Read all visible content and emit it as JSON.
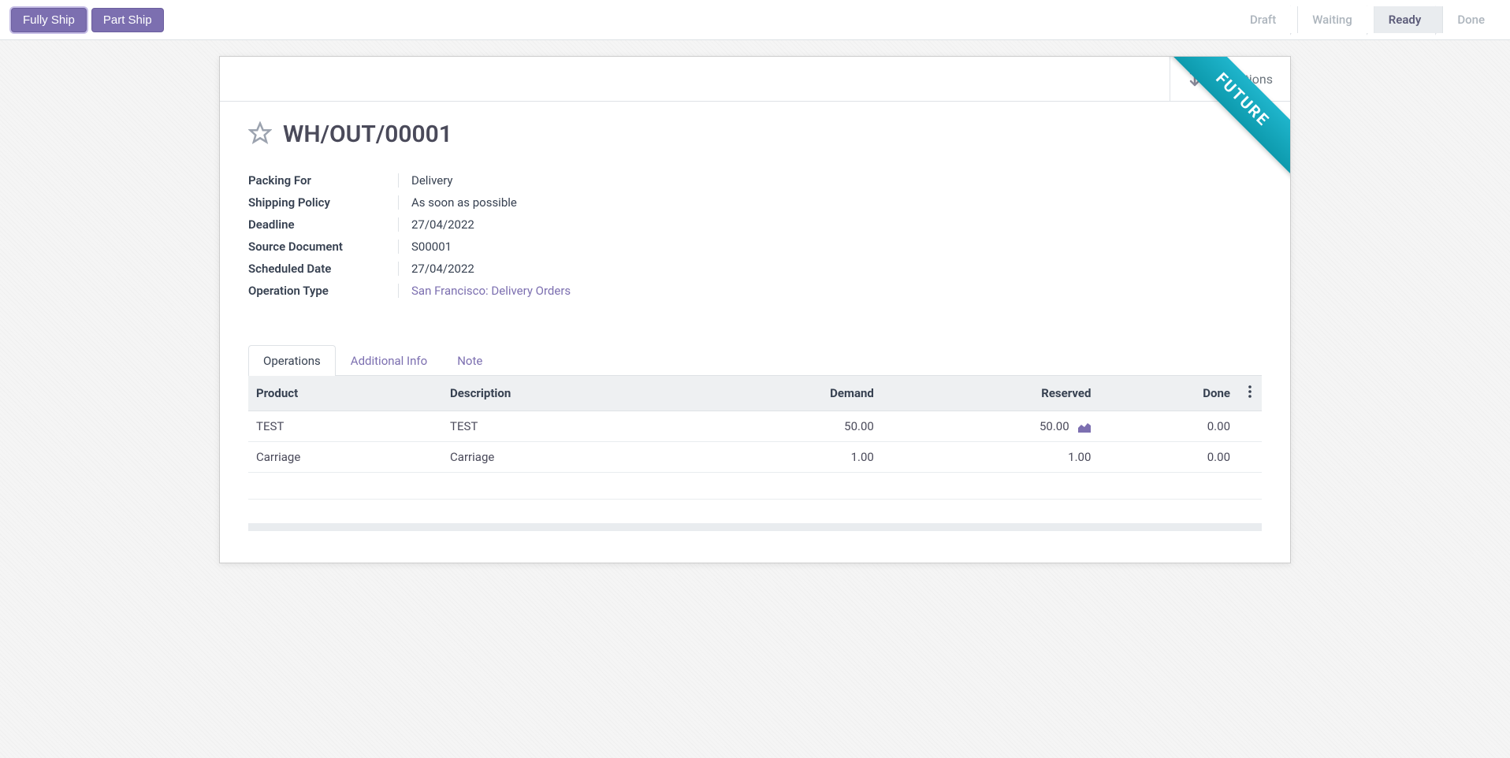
{
  "toolbar": {
    "fully_ship": "Fully Ship",
    "part_ship": "Part Ship"
  },
  "status": {
    "steps": [
      "Draft",
      "Waiting",
      "Ready",
      "Done"
    ],
    "active_index": 2
  },
  "stat_button": {
    "label": "Operations"
  },
  "ribbon": "FUTURE",
  "record": {
    "title": "WH/OUT/00001"
  },
  "fields": {
    "packing_for": {
      "label": "Packing For",
      "value": "Delivery"
    },
    "shipping_policy": {
      "label": "Shipping Policy",
      "value": "As soon as possible"
    },
    "deadline": {
      "label": "Deadline",
      "value": "27/04/2022"
    },
    "source_document": {
      "label": "Source Document",
      "value": "S00001"
    },
    "scheduled_date": {
      "label": "Scheduled Date",
      "value": "27/04/2022"
    },
    "operation_type": {
      "label": "Operation Type",
      "value": "San Francisco: Delivery Orders"
    }
  },
  "tabs": {
    "operations": "Operations",
    "additional_info": "Additional Info",
    "note": "Note"
  },
  "table": {
    "headers": {
      "product": "Product",
      "description": "Description",
      "demand": "Demand",
      "reserved": "Reserved",
      "done": "Done"
    },
    "rows": [
      {
        "product": "TEST",
        "description": "TEST",
        "demand": "50.00",
        "reserved": "50.00",
        "done": "0.00",
        "has_forecast": true
      },
      {
        "product": "Carriage",
        "description": "Carriage",
        "demand": "1.00",
        "reserved": "1.00",
        "done": "0.00",
        "has_forecast": false
      }
    ]
  }
}
